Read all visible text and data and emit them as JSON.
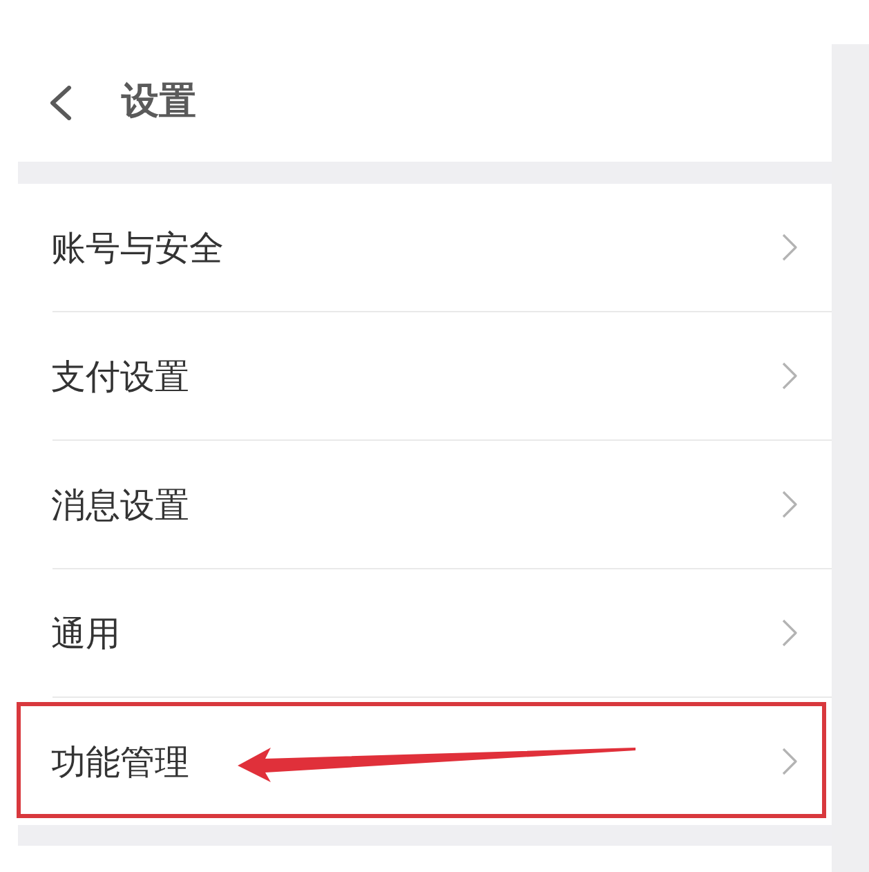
{
  "header": {
    "title": "设置"
  },
  "menu": [
    {
      "label": "账号与安全",
      "highlighted": false
    },
    {
      "label": "支付设置",
      "highlighted": false
    },
    {
      "label": "消息设置",
      "highlighted": false
    },
    {
      "label": "通用",
      "highlighted": false
    },
    {
      "label": "功能管理",
      "highlighted": true
    }
  ]
}
